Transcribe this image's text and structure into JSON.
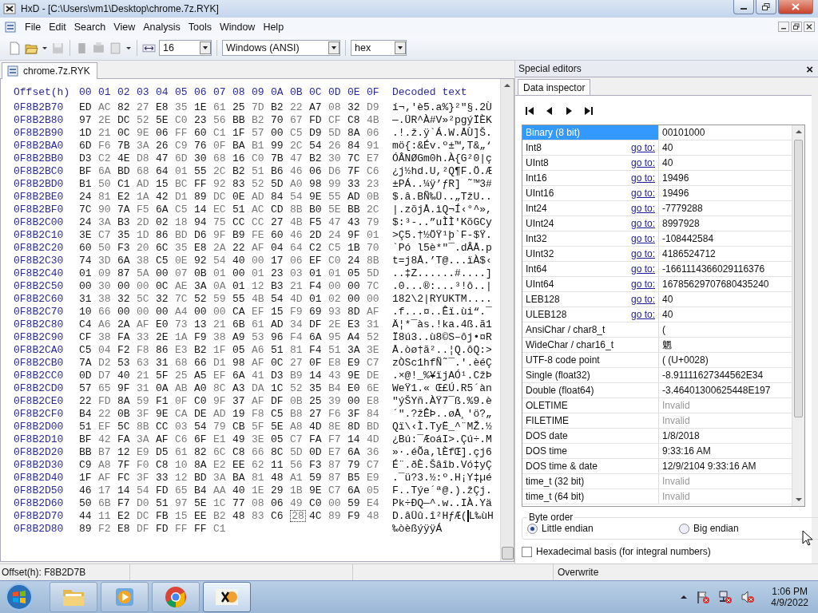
{
  "window": {
    "title": "HxD - [C:\\Users\\vm1\\Desktop\\chrome.7z.RYK]"
  },
  "menu": [
    "File",
    "Edit",
    "Search",
    "View",
    "Analysis",
    "Tools",
    "Window",
    "Help"
  ],
  "toolbar": {
    "bytes_per_row": "16",
    "charset": "Windows (ANSI)",
    "base": "hex"
  },
  "file_tab": {
    "label": "chrome.7z.RYK",
    "selected": true
  },
  "hex": {
    "offset_header": "Offset(h)",
    "columns": [
      "00",
      "01",
      "02",
      "03",
      "04",
      "05",
      "06",
      "07",
      "08",
      "09",
      "0A",
      "0B",
      "0C",
      "0D",
      "0E",
      "0F"
    ],
    "decoded_header": "Decoded text",
    "rows": [
      {
        "offset": "0F8B2B70",
        "bytes": [
          "ED",
          "AC",
          "82",
          "27",
          "E8",
          "35",
          "1E",
          "61",
          "25",
          "7D",
          "B2",
          "22",
          "A7",
          "08",
          "32",
          "D9"
        ],
        "text": "í¬‚'è5.a%}²\"§.2Ù"
      },
      {
        "offset": "0F8B2B80",
        "bytes": [
          "97",
          "2E",
          "DC",
          "52",
          "5E",
          "C0",
          "23",
          "56",
          "BB",
          "B2",
          "70",
          "67",
          "FD",
          "CF",
          "C8",
          "4B"
        ],
        "text": "—.ÜR^À#V»²pgýÏÈK"
      },
      {
        "offset": "0F8B2B90",
        "bytes": [
          "1D",
          "21",
          "0C",
          "9E",
          "06",
          "FF",
          "60",
          "C1",
          "1F",
          "57",
          "00",
          "C5",
          "D9",
          "5D",
          "8A",
          "06"
        ],
        "text": ".!.ž.ÿ`Á.W.ÅÙ]Š."
      },
      {
        "offset": "0F8B2BA0",
        "bytes": [
          "6D",
          "F6",
          "7B",
          "3A",
          "26",
          "C9",
          "76",
          "0F",
          "BA",
          "B1",
          "99",
          "2C",
          "54",
          "26",
          "84",
          "91"
        ],
        "text": "mö{:&Év.º±™,T&„‘"
      },
      {
        "offset": "0F8B2BB0",
        "bytes": [
          "D3",
          "C2",
          "4E",
          "D8",
          "47",
          "6D",
          "30",
          "68",
          "16",
          "C0",
          "7B",
          "47",
          "B2",
          "30",
          "7C",
          "E7"
        ],
        "text": "ÓÂNØGm0h.À{G²0|ç"
      },
      {
        "offset": "0F8B2BC0",
        "bytes": [
          "BF",
          "6A",
          "BD",
          "68",
          "64",
          "01",
          "55",
          "2C",
          "B2",
          "51",
          "B6",
          "46",
          "06",
          "D6",
          "7F",
          "C6"
        ],
        "text": "¿j½hd.U,²Q¶F.Ö.Æ"
      },
      {
        "offset": "0F8B2BD0",
        "bytes": [
          "B1",
          "50",
          "C1",
          "AD",
          "15",
          "BC",
          "FF",
          "92",
          "83",
          "52",
          "5D",
          "A0",
          "98",
          "99",
          "33",
          "23"
        ],
        "text": "±PÁ..¼ÿ’ƒR] ˜™3#"
      },
      {
        "offset": "0F8B2BE0",
        "bytes": [
          "24",
          "81",
          "E2",
          "1A",
          "42",
          "D1",
          "89",
          "DC",
          "0E",
          "AD",
          "84",
          "54",
          "9E",
          "55",
          "AD",
          "0B"
        ],
        "text": "$.â.BÑ‰Ü..„TžU.."
      },
      {
        "offset": "0F8B2BF0",
        "bytes": [
          "7C",
          "90",
          "7A",
          "F5",
          "6A",
          "C5",
          "14",
          "EC",
          "51",
          "AC",
          "CD",
          "8B",
          "B0",
          "5E",
          "BB",
          "2C"
        ],
        "text": "|.zõjÅ.ìQ¬Í‹°^»,"
      },
      {
        "offset": "0F8B2C00",
        "bytes": [
          "24",
          "3A",
          "B3",
          "2D",
          "02",
          "18",
          "94",
          "75",
          "CC",
          "CC",
          "27",
          "4B",
          "F5",
          "47",
          "43",
          "79"
        ],
        "text": "$:³-..”uÌÌ'KõGCy"
      },
      {
        "offset": "0F8B2C10",
        "bytes": [
          "3E",
          "C7",
          "35",
          "1D",
          "86",
          "BD",
          "D6",
          "9F",
          "B9",
          "FE",
          "60",
          "46",
          "2D",
          "24",
          "9F",
          "01"
        ],
        "text": ">Ç5.†½ÖŸ¹þ`F-$Ÿ."
      },
      {
        "offset": "0F8B2C20",
        "bytes": [
          "60",
          "50",
          "F3",
          "20",
          "6C",
          "35",
          "E8",
          "2A",
          "22",
          "AF",
          "04",
          "64",
          "C2",
          "C5",
          "1B",
          "70"
        ],
        "text": "`Pó l5è*\"¯.dÂÅ.p"
      },
      {
        "offset": "0F8B2C30",
        "bytes": [
          "74",
          "3D",
          "6A",
          "38",
          "C5",
          "0E",
          "92",
          "54",
          "40",
          "00",
          "17",
          "06",
          "EF",
          "C0",
          "24",
          "8B"
        ],
        "text": "t=j8Å.’T@...ïÀ$‹"
      },
      {
        "offset": "0F8B2C40",
        "bytes": [
          "01",
          "09",
          "87",
          "5A",
          "00",
          "07",
          "0B",
          "01",
          "00",
          "01",
          "23",
          "03",
          "01",
          "01",
          "05",
          "5D"
        ],
        "text": "..‡Z......#....]"
      },
      {
        "offset": "0F8B2C50",
        "bytes": [
          "00",
          "30",
          "00",
          "00",
          "0C",
          "AE",
          "3A",
          "0A",
          "01",
          "12",
          "B3",
          "21",
          "F4",
          "00",
          "00",
          "7C"
        ],
        "text": ".0...®:...³!ô..|"
      },
      {
        "offset": "0F8B2C60",
        "bytes": [
          "31",
          "38",
          "32",
          "5C",
          "32",
          "7C",
          "52",
          "59",
          "55",
          "4B",
          "54",
          "4D",
          "01",
          "02",
          "00",
          "00"
        ],
        "text": "182\\2|RYUKTM...."
      },
      {
        "offset": "0F8B2C70",
        "bytes": [
          "10",
          "66",
          "00",
          "00",
          "00",
          "A4",
          "00",
          "00",
          "CA",
          "EF",
          "15",
          "F9",
          "69",
          "93",
          "8D",
          "AF"
        ],
        "text": ".f...¤..Êï.ùi“.¯"
      },
      {
        "offset": "0F8B2C80",
        "bytes": [
          "C4",
          "A6",
          "2A",
          "AF",
          "E0",
          "73",
          "13",
          "21",
          "6B",
          "61",
          "AD",
          "34",
          "DF",
          "2E",
          "E3",
          "31"
        ],
        "text": "Ä¦*¯às.!ka.4ß.ã1"
      },
      {
        "offset": "0F8B2C90",
        "bytes": [
          "CF",
          "38",
          "FA",
          "33",
          "2E",
          "1A",
          "F9",
          "38",
          "A9",
          "53",
          "96",
          "F4",
          "6A",
          "95",
          "A4",
          "52"
        ],
        "text": "Ï8ú3..ù8©S–ôj•¤R"
      },
      {
        "offset": "0F8B2CA0",
        "bytes": [
          "C5",
          "04",
          "F2",
          "F8",
          "86",
          "E3",
          "B2",
          "1F",
          "05",
          "A6",
          "51",
          "81",
          "F4",
          "51",
          "3A",
          "3E"
        ],
        "text": "Å.òø†ã²..¦Q.ôQ:>"
      },
      {
        "offset": "0F8B2CB0",
        "bytes": [
          "7A",
          "D2",
          "53",
          "63",
          "31",
          "68",
          "66",
          "D1",
          "98",
          "AF",
          "0C",
          "27",
          "0F",
          "E8",
          "E9",
          "C7"
        ],
        "text": "zÒSc1hfÑ˜¯.'.èéÇ"
      },
      {
        "offset": "0F8B2CC0",
        "bytes": [
          "0D",
          "D7",
          "40",
          "21",
          "5F",
          "25",
          "A5",
          "EF",
          "6A",
          "41",
          "D3",
          "B9",
          "14",
          "43",
          "9E",
          "DE"
        ],
        "text": ".×@!_%¥ïjAÓ¹.CžÞ"
      },
      {
        "offset": "0F8B2CD0",
        "bytes": [
          "57",
          "65",
          "9F",
          "31",
          "0A",
          "AB",
          "A0",
          "8C",
          "A3",
          "DA",
          "1C",
          "52",
          "35",
          "B4",
          "E0",
          "6E"
        ],
        "text": "WeŸ1.« Œ£Ú.R5´àn"
      },
      {
        "offset": "0F8B2CE0",
        "bytes": [
          "22",
          "FD",
          "8A",
          "59",
          "F1",
          "0F",
          "C0",
          "9F",
          "37",
          "AF",
          "DF",
          "0B",
          "25",
          "39",
          "00",
          "E8"
        ],
        "text": "\"ýŠYñ.ÀŸ7¯ß.%9.è"
      },
      {
        "offset": "0F8B2CF0",
        "bytes": [
          "B4",
          "22",
          "0B",
          "3F",
          "9E",
          "CA",
          "DE",
          "AD",
          "19",
          "F8",
          "C5",
          "B8",
          "27",
          "F6",
          "3F",
          "84"
        ],
        "text": "´\".?žÊÞ..øÅ¸'ö?„"
      },
      {
        "offset": "0F8B2D00",
        "bytes": [
          "51",
          "EF",
          "5C",
          "8B",
          "CC",
          "03",
          "54",
          "79",
          "CB",
          "5F",
          "5E",
          "A8",
          "4D",
          "8E",
          "8D",
          "BD"
        ],
        "text": "Qï\\‹Ì.TyË_^¨MŽ.½"
      },
      {
        "offset": "0F8B2D10",
        "bytes": [
          "BF",
          "42",
          "FA",
          "3A",
          "AF",
          "C6",
          "6F",
          "E1",
          "49",
          "3E",
          "05",
          "C7",
          "FA",
          "F7",
          "14",
          "4D"
        ],
        "text": "¿Bú:¯ÆoáI>.Çú÷.M"
      },
      {
        "offset": "0F8B2D20",
        "bytes": [
          "BB",
          "B7",
          "12",
          "E9",
          "D5",
          "61",
          "82",
          "6C",
          "C8",
          "66",
          "8C",
          "5D",
          "0D",
          "E7",
          "6A",
          "36"
        ],
        "text": "»·.éÕa‚lÈfŒ].çj6"
      },
      {
        "offset": "0F8B2D30",
        "bytes": [
          "C9",
          "A8",
          "7F",
          "F0",
          "C8",
          "10",
          "8A",
          "E2",
          "EE",
          "62",
          "11",
          "56",
          "F3",
          "87",
          "79",
          "C7"
        ],
        "text": "É¨.ðÈ.Šâîb.Vó‡yÇ"
      },
      {
        "offset": "0F8B2D40",
        "bytes": [
          "1F",
          "AF",
          "FC",
          "3F",
          "33",
          "12",
          "BD",
          "3A",
          "BA",
          "81",
          "48",
          "A1",
          "59",
          "87",
          "B5",
          "E9"
        ],
        "text": ".¯ü?3.½:º.H¡Y‡µé"
      },
      {
        "offset": "0F8B2D50",
        "bytes": [
          "46",
          "17",
          "14",
          "54",
          "FD",
          "65",
          "B4",
          "AA",
          "40",
          "1E",
          "29",
          "1B",
          "9E",
          "C7",
          "6A",
          "05"
        ],
        "text": "F..Týe´ª@.).žÇj."
      },
      {
        "offset": "0F8B2D60",
        "bytes": [
          "50",
          "6B",
          "F7",
          "D0",
          "51",
          "97",
          "5E",
          "1C",
          "77",
          "08",
          "06",
          "49",
          "C0",
          "00",
          "59",
          "E4"
        ],
        "text": "Pk÷ÐQ—^.w..IÀ.Yä"
      },
      {
        "offset": "0F8B2D70",
        "bytes": [
          "44",
          "11",
          "E2",
          "DC",
          "FB",
          "15",
          "EE",
          "B2",
          "48",
          "83",
          "C6"
        ],
        "cursor_byte": "28",
        "bytes_after": [
          "4C",
          "89",
          "F9",
          "48"
        ],
        "text": "D.âÜû.î²HƒÆ",
        "cursor_char": "(",
        "text_after": "L‰ùH"
      },
      {
        "offset": "0F8B2D80",
        "bytes": [
          "89",
          "F2",
          "E8",
          "DF",
          "FD",
          "FF",
          "FF",
          "C1"
        ],
        "text": "‰òèßýÿÿÁ"
      }
    ]
  },
  "inspector": {
    "title": "Special editors",
    "close": "×",
    "tab": "Data inspector",
    "rows": [
      {
        "label": "Binary (8 bit)",
        "value": "00101000",
        "valid": true,
        "selected": true
      },
      {
        "label": "Int8",
        "goto": "go to:",
        "value": "40",
        "valid": true,
        "selected": false
      },
      {
        "label": "UInt8",
        "goto": "go to:",
        "value": "40",
        "valid": true,
        "selected": false
      },
      {
        "label": "Int16",
        "goto": "go to:",
        "value": "19496",
        "valid": true,
        "selected": false
      },
      {
        "label": "UInt16",
        "goto": "go to:",
        "value": "19496",
        "valid": true,
        "selected": false
      },
      {
        "label": "Int24",
        "goto": "go to:",
        "value": "-7779288",
        "valid": true,
        "selected": false
      },
      {
        "label": "UInt24",
        "goto": "go to:",
        "value": "8997928",
        "valid": true,
        "selected": false
      },
      {
        "label": "Int32",
        "goto": "go to:",
        "value": "-108442584",
        "valid": true,
        "selected": false
      },
      {
        "label": "UInt32",
        "goto": "go to:",
        "value": "4186524712",
        "valid": true,
        "selected": false
      },
      {
        "label": "Int64",
        "goto": "go to:",
        "value": "-1661114366029116376",
        "valid": true,
        "selected": false
      },
      {
        "label": "UInt64",
        "goto": "go to:",
        "value": "16785629707680435240",
        "valid": true,
        "selected": false
      },
      {
        "label": "LEB128",
        "goto": "go to:",
        "value": "40",
        "valid": true,
        "selected": false
      },
      {
        "label": "ULEB128",
        "goto": "go to:",
        "value": "40",
        "valid": true,
        "selected": false
      },
      {
        "label": "AnsiChar / char8_t",
        "value": "(",
        "valid": true,
        "selected": false
      },
      {
        "label": "WideChar / char16_t",
        "value": "魍",
        "valid": true,
        "selected": false
      },
      {
        "label": "UTF-8 code point",
        "value": "( (U+0028)",
        "valid": true,
        "selected": false
      },
      {
        "label": "Single (float32)",
        "value": "-8.91111627344562E34",
        "valid": true,
        "selected": false
      },
      {
        "label": "Double (float64)",
        "value": "-3.46401300625448E197",
        "valid": true,
        "selected": false
      },
      {
        "label": "OLETIME",
        "value": "Invalid",
        "valid": false,
        "selected": false
      },
      {
        "label": "FILETIME",
        "value": "Invalid",
        "valid": false,
        "selected": false
      },
      {
        "label": "DOS date",
        "value": "1/8/2018",
        "valid": true,
        "selected": false
      },
      {
        "label": "DOS time",
        "value": "9:33:16 AM",
        "valid": true,
        "selected": false
      },
      {
        "label": "DOS time & date",
        "value": "12/9/2104 9:33:16 AM",
        "valid": true,
        "selected": false
      },
      {
        "label": "time_t (32 bit)",
        "value": "Invalid",
        "valid": false,
        "selected": false
      },
      {
        "label": "time_t (64 bit)",
        "value": "Invalid",
        "valid": false,
        "selected": false
      }
    ],
    "byte_order": {
      "label": "Byte order",
      "options": [
        {
          "label": "Little endian",
          "selected": true
        },
        {
          "label": "Big endian",
          "selected": false
        }
      ]
    },
    "hex_basis": {
      "label": "Hexadecimal basis (for integral numbers)",
      "checked": false
    }
  },
  "status_bar": {
    "offset": "Offset(h): F8B2D7B",
    "mode": "Overwrite"
  },
  "taskbar": {
    "apps": [
      {
        "kind": "folder",
        "active": false
      },
      {
        "kind": "player",
        "active": false
      },
      {
        "kind": "browser",
        "active": false
      },
      {
        "kind": "hex",
        "active": true
      }
    ],
    "time": "1:06 PM",
    "date": "4/9/2022"
  }
}
